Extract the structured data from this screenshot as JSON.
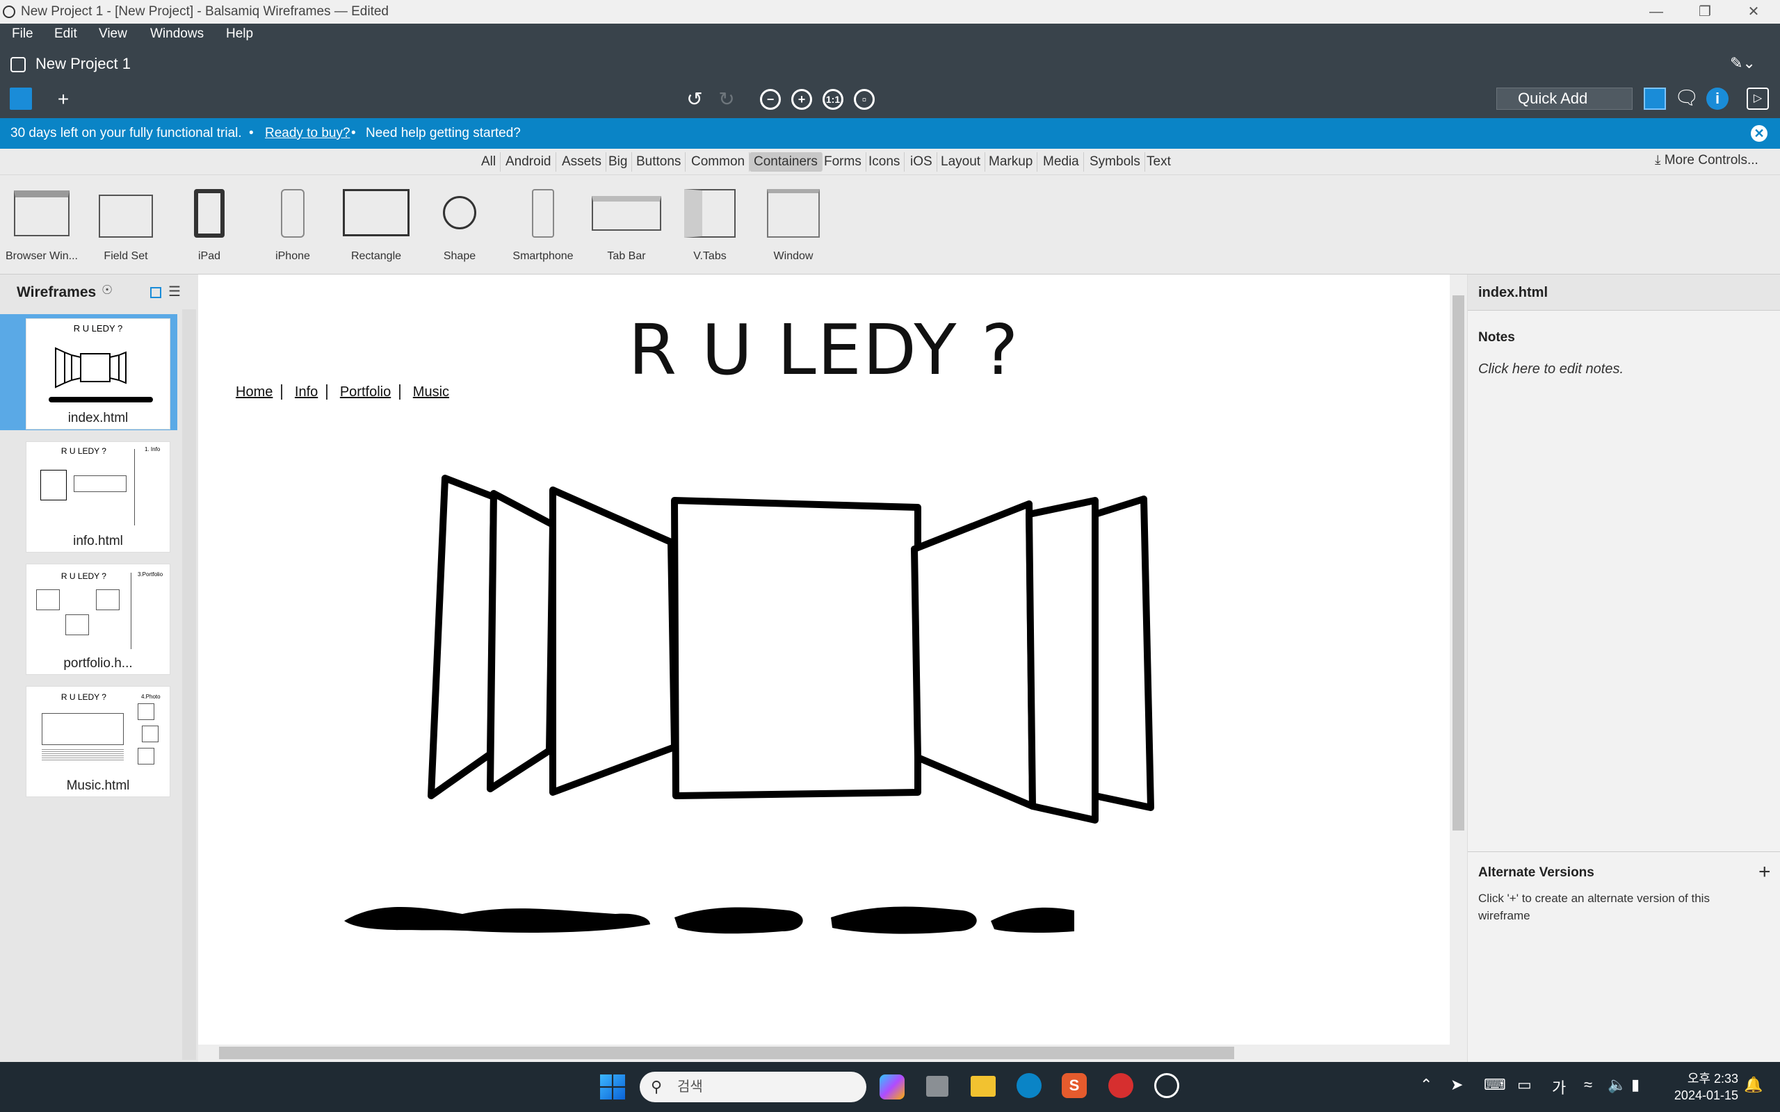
{
  "window": {
    "title": "New Project 1 - [New Project] - Balsamiq Wireframes — Edited"
  },
  "menu": {
    "file": "File",
    "edit": "Edit",
    "view": "View",
    "windows": "Windows",
    "help": "Help"
  },
  "project": {
    "name": "New Project 1"
  },
  "toolbar": {
    "quick_add": "Quick Add"
  },
  "trial": {
    "days_left": "30 days left on your fully functional trial.",
    "buy": "Ready to buy?",
    "help": "Need help getting started?"
  },
  "categories": [
    "All",
    "Android",
    "Assets",
    "Big",
    "Buttons",
    "Common",
    "Containers",
    "Forms",
    "Icons",
    "iOS",
    "Layout",
    "Markup",
    "Media",
    "Symbols",
    "Text"
  ],
  "active_category": "Containers",
  "more_controls": "More Controls...",
  "library": [
    "Browser Win...",
    "Field Set",
    "iPad",
    "iPhone",
    "Rectangle",
    "Shape",
    "Smartphone",
    "Tab Bar",
    "V.Tabs",
    "Window"
  ],
  "wireframes": {
    "heading": "Wireframes",
    "items": [
      {
        "label": "index.html",
        "title": "R U LEDY ?"
      },
      {
        "label": "info.html",
        "title": "R U LEDY ?",
        "side": "1. Info"
      },
      {
        "label": "portfolio.h...",
        "title": "R U LEDY ?",
        "side": "3.Portfolio"
      },
      {
        "label": "Music.html",
        "title": "R U LEDY ?",
        "side": "4.Photo"
      }
    ]
  },
  "canvas": {
    "title": "R U LEDY ?",
    "nav": [
      "Home",
      "Info",
      "Portfolio",
      "Music"
    ]
  },
  "right_panel": {
    "page": "index.html",
    "notes_heading": "Notes",
    "notes_text": "Click here to edit notes.",
    "alt_heading": "Alternate Versions",
    "alt_text": "Click '+' to create an alternate version of this wireframe"
  },
  "taskbar": {
    "search": "검색",
    "ime": "가",
    "time": "오후 2:33",
    "date": "2024-01-15"
  },
  "colors": {
    "accent": "#0a84c6",
    "toolbar": "#39434b",
    "selected": "#5aa9e6"
  }
}
